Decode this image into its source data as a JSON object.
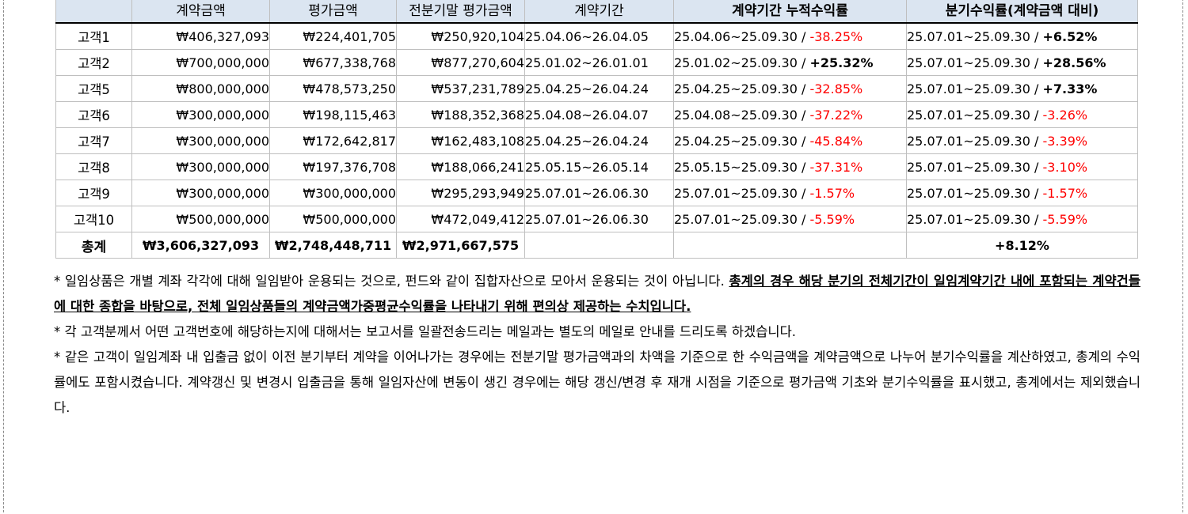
{
  "table": {
    "headers": [
      "",
      "계약금액",
      "평가금액",
      "전분기말 평가금액",
      "계약기간",
      "계약기간 누적수익률",
      "분기수익률(계약금액 대비)"
    ],
    "header_sub": [
      "",
      "",
      "평가금액",
      "",
      "",
      "",
      ""
    ],
    "rows": [
      {
        "name": "고객1",
        "contract": "₩406,327,093",
        "eval": "₩224,401,705",
        "prev": "₩250,920,104",
        "period": "25.04.06~26.04.05",
        "cum_period": "25.04.06~25.09.30",
        "cum_rate": "-38.25%",
        "cum_sign": "neg",
        "q_period": "25.07.01~25.09.30",
        "q_rate": "+6.52%",
        "q_sign": "pos"
      },
      {
        "name": "고객2",
        "contract": "₩700,000,000",
        "eval": "₩677,338,768",
        "prev": "₩877,270,604",
        "period": "25.01.02~26.01.01",
        "cum_period": "25.01.02~25.09.30",
        "cum_rate": "+25.32%",
        "cum_sign": "pos",
        "q_period": "25.07.01~25.09.30",
        "q_rate": "+28.56%",
        "q_sign": "pos"
      },
      {
        "name": "고객5",
        "contract": "₩800,000,000",
        "eval": "₩478,573,250",
        "prev": "₩537,231,789",
        "period": "25.04.25~26.04.24",
        "cum_period": "25.04.25~25.09.30",
        "cum_rate": "-32.85%",
        "cum_sign": "neg",
        "q_period": "25.07.01~25.09.30",
        "q_rate": "+7.33%",
        "q_sign": "pos"
      },
      {
        "name": "고객6",
        "contract": "₩300,000,000",
        "eval": "₩198,115,463",
        "prev": "₩188,352,368",
        "period": "25.04.08~26.04.07",
        "cum_period": "25.04.08~25.09.30",
        "cum_rate": "-37.22%",
        "cum_sign": "neg",
        "q_period": "25.07.01~25.09.30",
        "q_rate": "-3.26%",
        "q_sign": "neg"
      },
      {
        "name": "고객7",
        "contract": "₩300,000,000",
        "eval": "₩172,642,817",
        "prev": "₩162,483,108",
        "period": "25.04.25~26.04.24",
        "cum_period": "25.04.25~25.09.30",
        "cum_rate": "-45.84%",
        "cum_sign": "neg",
        "q_period": "25.07.01~25.09.30",
        "q_rate": "-3.39%",
        "q_sign": "neg"
      },
      {
        "name": "고객8",
        "contract": "₩300,000,000",
        "eval": "₩197,376,708",
        "prev": "₩188,066,241",
        "period": "25.05.15~26.05.14",
        "cum_period": "25.05.15~25.09.30",
        "cum_rate": "-37.31%",
        "cum_sign": "neg",
        "q_period": "25.07.01~25.09.30",
        "q_rate": "-3.10%",
        "q_sign": "neg"
      },
      {
        "name": "고객9",
        "contract": "₩300,000,000",
        "eval": "₩300,000,000",
        "prev": "₩295,293,949",
        "period": "25.07.01~26.06.30",
        "cum_period": "25.07.01~25.09.30",
        "cum_rate": "-1.57%",
        "cum_sign": "neg",
        "q_period": "25.07.01~25.09.30",
        "q_rate": "-1.57%",
        "q_sign": "neg"
      },
      {
        "name": "고객10",
        "contract": "₩500,000,000",
        "eval": "₩500,000,000",
        "prev": "₩472,049,412",
        "period": "25.07.01~26.06.30",
        "cum_period": "25.07.01~25.09.30",
        "cum_rate": "-5.59%",
        "cum_sign": "neg",
        "q_period": "25.07.01~25.09.30",
        "q_rate": "-5.59%",
        "q_sign": "neg"
      }
    ],
    "total": {
      "label": "총계",
      "contract": "₩3,606,327,093",
      "eval": "₩2,748,448,711",
      "prev": "₩2,971,667,575",
      "q_rate": "+8.12%"
    },
    "separator": " / "
  },
  "notes": {
    "n1_plain": "* 일임상품은 개별 계좌 각각에 대해 일임받아 운용되는 것으로, 펀드와 같이 집합자산으로 모아서 운용되는 것이 아닙니다. ",
    "n1_bold": "총계의 경우 해당 분기의 전체기간이 일임계약기간 내에 포함되는 계약건들에 대한 종합을 바탕으로, 전체 일임상품들의 계약금액가중평균수익률을 나타내기 위해 편의상 제공하는 수치입니다",
    "n1_end": ".",
    "n2": "* 각 고객분께서 어떤 고객번호에 해당하는지에 대해서는 보고서를 일괄전송드리는 메일과는 별도의 메일로 안내를 드리도록 하겠습니다.",
    "n3": "* 같은 고객이 일임계좌 내 입출금 없이 이전 분기부터 계약을 이어나가는 경우에는 전분기말 평가금액과의 차액을 기준으로 한 수익금액을 계약금액으로 나누어 분기수익률을 계산하였고, 총계의 수익률에도 포함시켰습니다. 계약갱신 및 변경시 입출금을 통해 일임자산에 변동이 생긴 경우에는 해당 갱신/변경 후 재개 시점을 기준으로 평가금액 기초와 분기수익률을 표시했고, 총계에서는 제외했습니다."
  }
}
